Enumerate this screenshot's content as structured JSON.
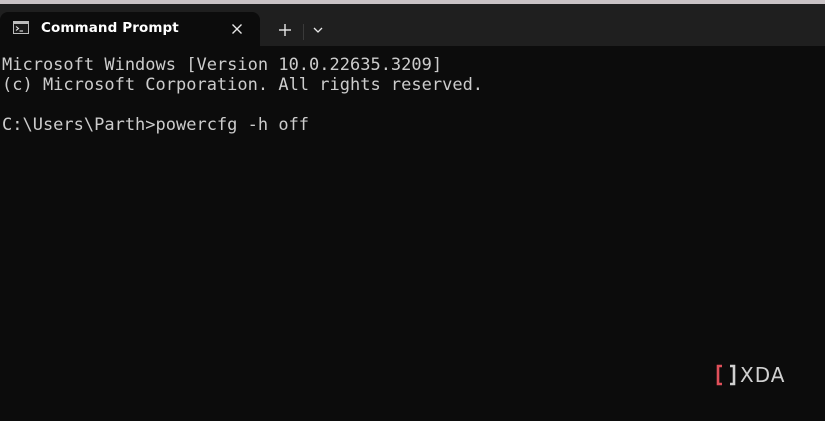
{
  "window": {
    "tab_title": "Command Prompt",
    "tab_icon": "command-prompt-icon",
    "close_icon": "close-icon",
    "new_tab_icon": "plus-icon",
    "dropdown_icon": "chevron-down-icon"
  },
  "terminal": {
    "lines": [
      "Microsoft Windows [Version 10.0.22635.3209]",
      "(c) Microsoft Corporation. All rights reserved.",
      "",
      "C:\\Users\\Parth>powercfg -h off"
    ],
    "background": "#0c0c0c",
    "foreground": "#cccccc"
  },
  "watermark": {
    "text": "XDA",
    "accent": "#e0505a"
  }
}
